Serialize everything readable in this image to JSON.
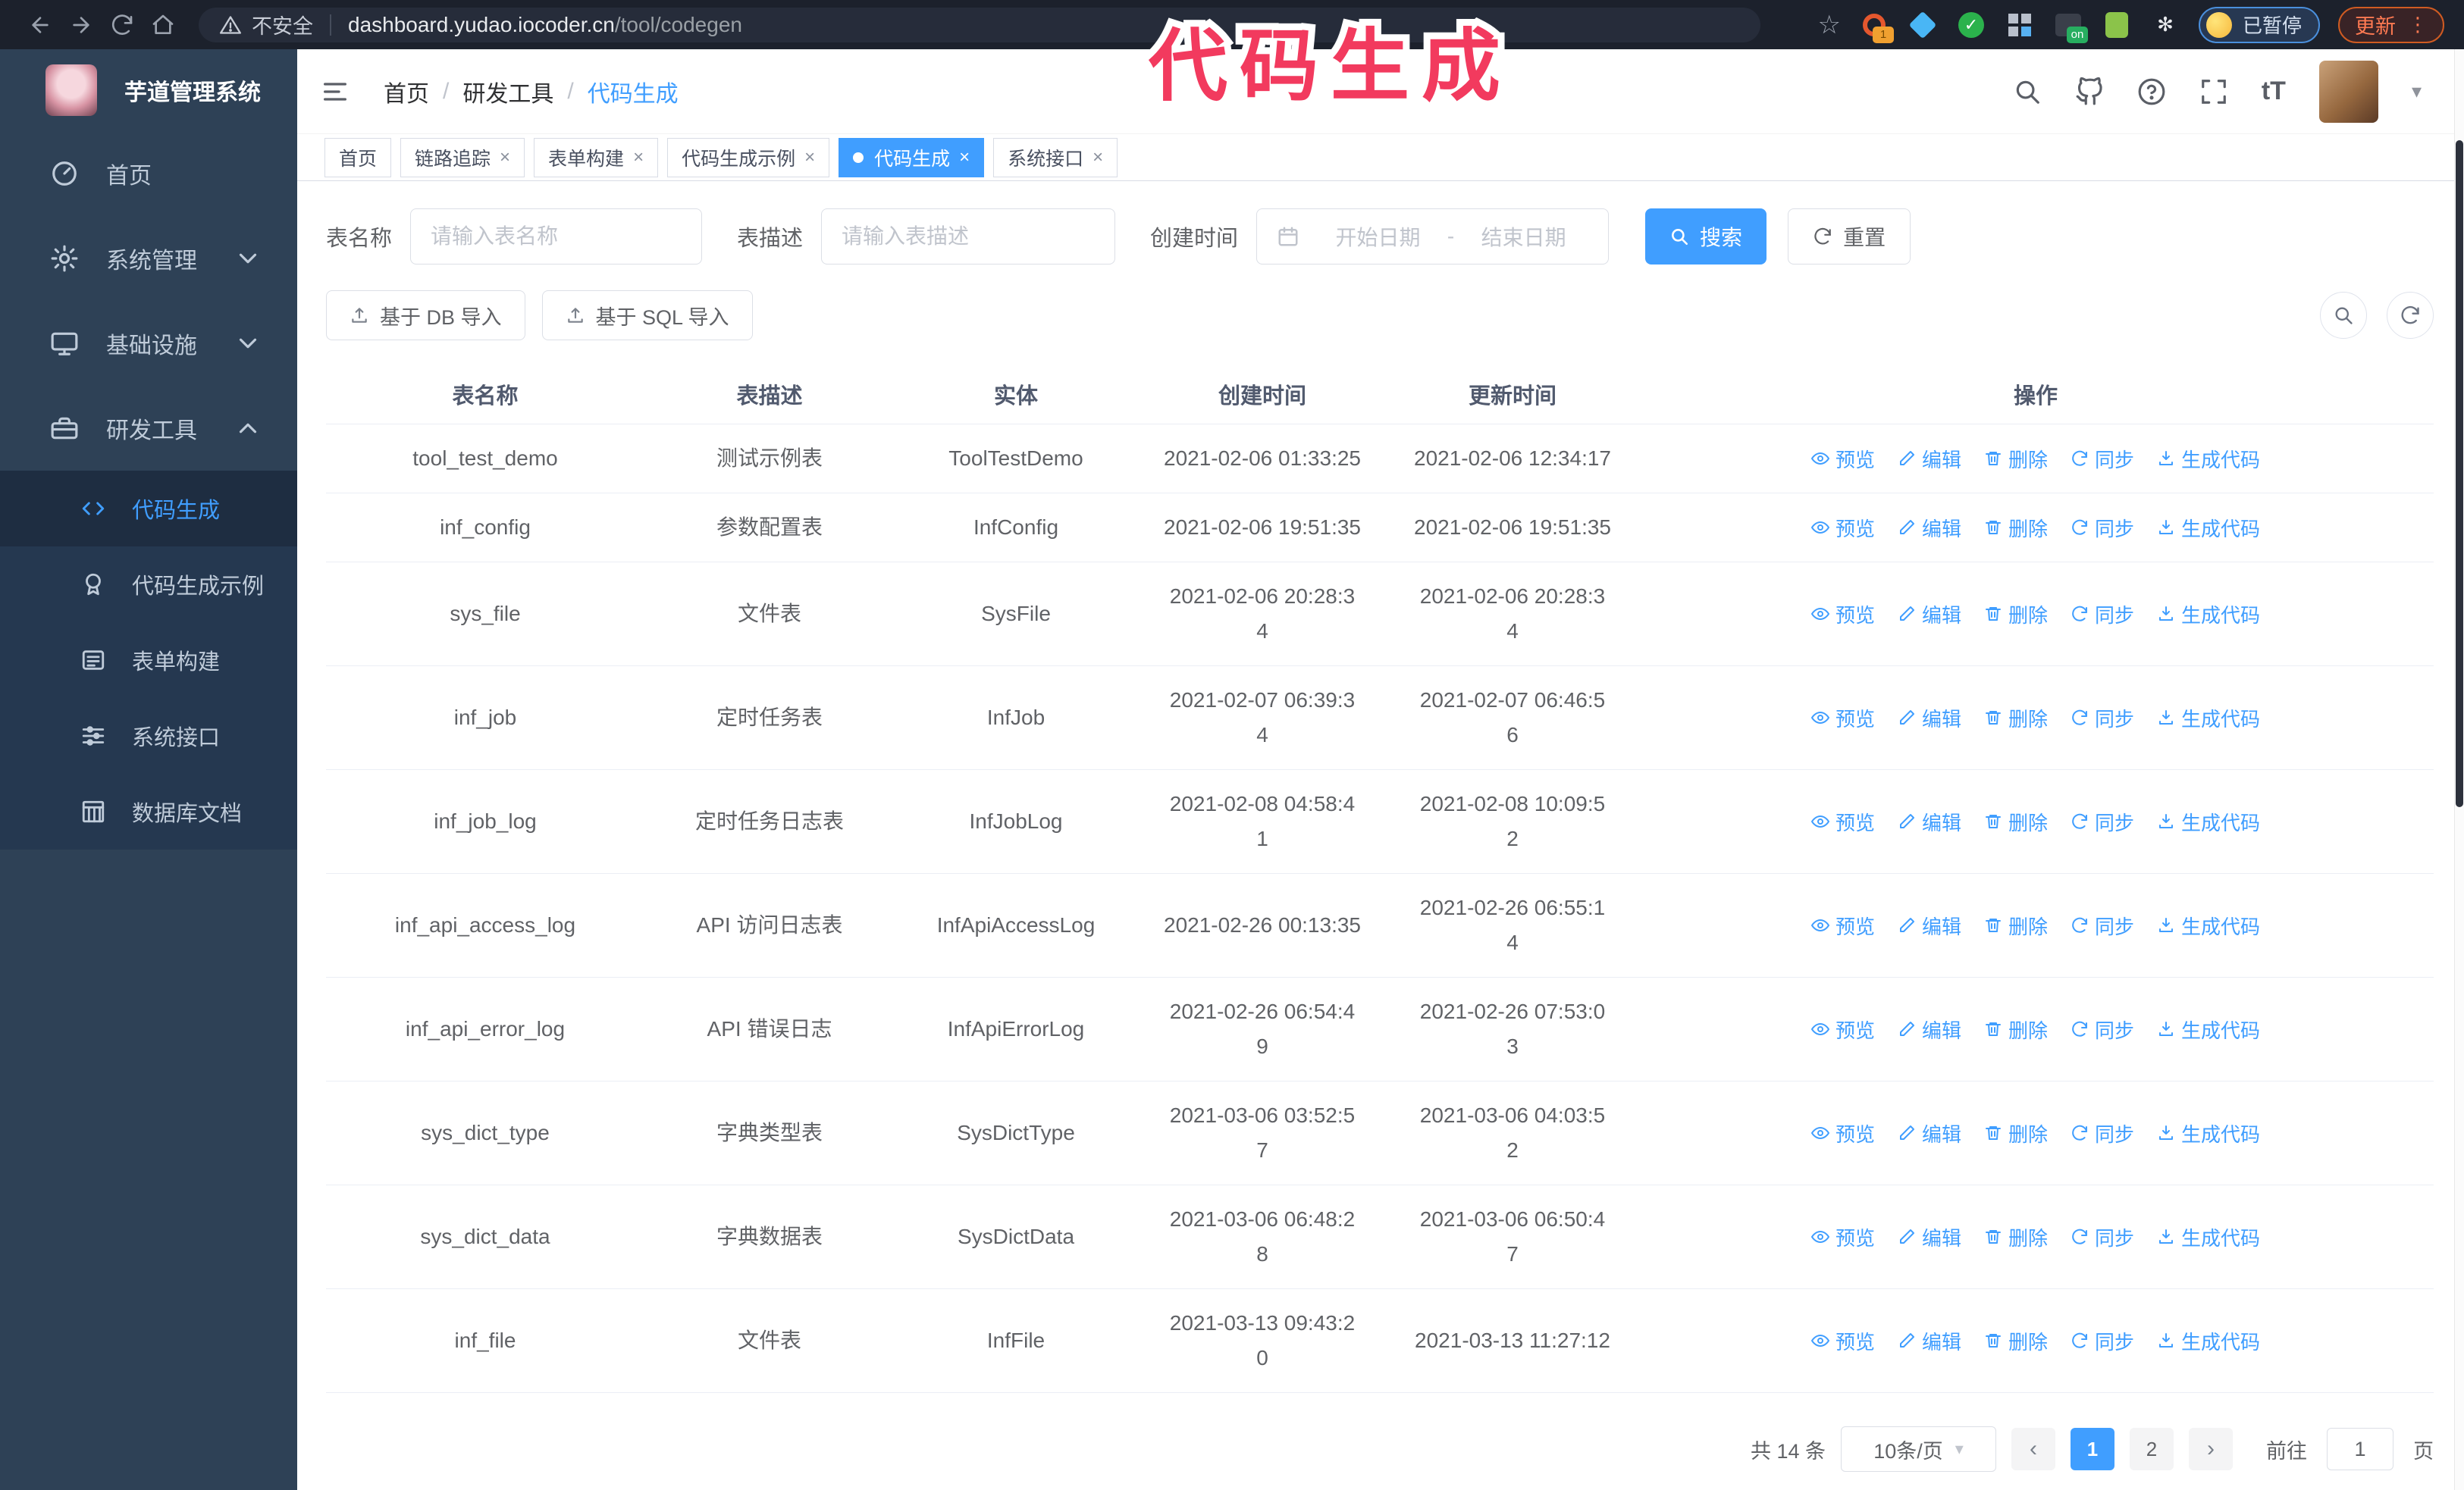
{
  "browser": {
    "security_label": "不安全",
    "url_domain": "dashboard.yudao.iocoder.cn",
    "url_path": "/tool/codegen",
    "ext_badge_count": "1",
    "ext_badge_on": "on",
    "paused_badge": "已暂停",
    "update_button": "更新"
  },
  "annotation": {
    "text": "代码生成",
    "color": "#f23a5e"
  },
  "sidebar": {
    "app_title": "芋道管理系统",
    "items": [
      {
        "label": "首页",
        "icon": "dashboard-icon",
        "expandable": false,
        "expanded": false
      },
      {
        "label": "系统管理",
        "icon": "gear-icon",
        "expandable": true,
        "expanded": false
      },
      {
        "label": "基础设施",
        "icon": "monitor-icon",
        "expandable": true,
        "expanded": false
      },
      {
        "label": "研发工具",
        "icon": "toolbox-icon",
        "expandable": true,
        "expanded": true
      }
    ],
    "subitems": [
      {
        "label": "代码生成",
        "icon": "code-icon",
        "active": true
      },
      {
        "label": "代码生成示例",
        "icon": "award-icon",
        "active": false
      },
      {
        "label": "表单构建",
        "icon": "form-icon",
        "active": false
      },
      {
        "label": "系统接口",
        "icon": "sliders-icon",
        "active": false
      },
      {
        "label": "数据库文档",
        "icon": "database-icon",
        "active": false
      }
    ]
  },
  "header": {
    "breadcrumb": [
      "首页",
      "研发工具",
      "代码生成"
    ],
    "separator": "/"
  },
  "tabs": [
    {
      "label": "首页",
      "closable": false,
      "active": false
    },
    {
      "label": "链路追踪",
      "closable": true,
      "active": false
    },
    {
      "label": "表单构建",
      "closable": true,
      "active": false
    },
    {
      "label": "代码生成示例",
      "closable": true,
      "active": false
    },
    {
      "label": "代码生成",
      "closable": true,
      "active": true
    },
    {
      "label": "系统接口",
      "closable": true,
      "active": false
    }
  ],
  "search_form": {
    "name_label": "表名称",
    "name_placeholder": "请输入表名称",
    "desc_label": "表描述",
    "desc_placeholder": "请输入表描述",
    "time_label": "创建时间",
    "start_placeholder": "开始日期",
    "range_separator": "-",
    "end_placeholder": "结束日期",
    "search_label": "搜索",
    "reset_label": "重置"
  },
  "toolbar": {
    "import_db_label": "基于 DB 导入",
    "import_sql_label": "基于 SQL 导入"
  },
  "table": {
    "columns": [
      "表名称",
      "表描述",
      "实体",
      "创建时间",
      "更新时间",
      "操作"
    ],
    "actions": [
      "预览",
      "编辑",
      "删除",
      "同步",
      "生成代码"
    ],
    "action_icons": [
      "eye-icon",
      "edit-icon",
      "delete-icon",
      "sync-icon",
      "download-icon"
    ],
    "rows": [
      {
        "name": "tool_test_demo",
        "desc": "测试示例表",
        "entity": "ToolTestDemo",
        "created": "2021-02-06 01:33:25",
        "updated": "2021-02-06 12:34:17"
      },
      {
        "name": "inf_config",
        "desc": "参数配置表",
        "entity": "InfConfig",
        "created": "2021-02-06 19:51:35",
        "updated": "2021-02-06 19:51:35"
      },
      {
        "name": "sys_file",
        "desc": "文件表",
        "entity": "SysFile",
        "created": "2021-02-06 20:28:3\n4",
        "updated": "2021-02-06 20:28:3\n4"
      },
      {
        "name": "inf_job",
        "desc": "定时任务表",
        "entity": "InfJob",
        "created": "2021-02-07 06:39:3\n4",
        "updated": "2021-02-07 06:46:5\n6"
      },
      {
        "name": "inf_job_log",
        "desc": "定时任务日志表",
        "entity": "InfJobLog",
        "created": "2021-02-08 04:58:4\n1",
        "updated": "2021-02-08 10:09:5\n2"
      },
      {
        "name": "inf_api_access_log",
        "desc": "API 访问日志表",
        "entity": "InfApiAccessLog",
        "created": "2021-02-26 00:13:35",
        "updated": "2021-02-26 06:55:1\n4"
      },
      {
        "name": "inf_api_error_log",
        "desc": "API 错误日志",
        "entity": "InfApiErrorLog",
        "created": "2021-02-26 06:54:4\n9",
        "updated": "2021-02-26 07:53:0\n3"
      },
      {
        "name": "sys_dict_type",
        "desc": "字典类型表",
        "entity": "SysDictType",
        "created": "2021-03-06 03:52:5\n7",
        "updated": "2021-03-06 04:03:5\n2"
      },
      {
        "name": "sys_dict_data",
        "desc": "字典数据表",
        "entity": "SysDictData",
        "created": "2021-03-06 06:48:2\n8",
        "updated": "2021-03-06 06:50:4\n7"
      },
      {
        "name": "inf_file",
        "desc": "文件表",
        "entity": "InfFile",
        "created": "2021-03-13 09:43:2\n0",
        "updated": "2021-03-13 11:27:12"
      }
    ]
  },
  "pagination": {
    "total_text": "共 14 条",
    "page_size": "10条/页",
    "pages": [
      "1",
      "2"
    ],
    "active_page": "1",
    "goto_label": "前往",
    "goto_value": "1",
    "goto_suffix": "页"
  }
}
